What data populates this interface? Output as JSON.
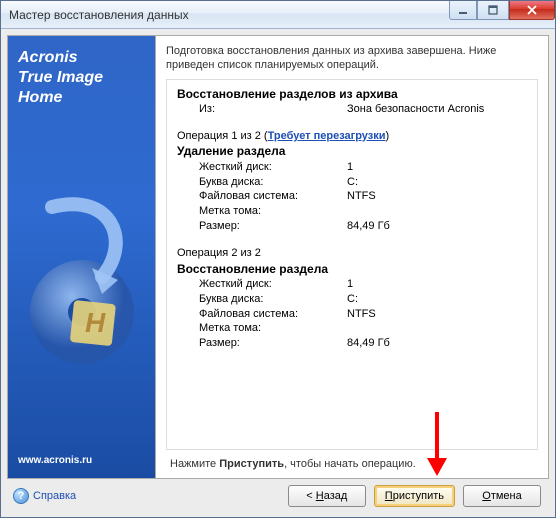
{
  "window": {
    "title": "Мастер восстановления данных"
  },
  "sidebar": {
    "brand_line1": "Acronis",
    "brand_line2": "True Image",
    "brand_line3": "Home",
    "url": "www.acronis.ru"
  },
  "intro": "Подготовка восстановления данных из архива завершена. Ниже приведен список планируемых операций.",
  "section": {
    "title": "Восстановление разделов из архива",
    "from_label": "Из:",
    "from_value": "Зона безопасности Acronis"
  },
  "ops": [
    {
      "heading_prefix": "Операция 1 из 2 (",
      "heading_link": "Требует перезагрузки",
      "heading_suffix": ")",
      "title": "Удаление раздела",
      "rows": {
        "hdd_k": "Жесткий диск:",
        "hdd_v": "1",
        "letter_k": "Буква диска:",
        "letter_v": "C:",
        "fs_k": "Файловая система:",
        "fs_v": "NTFS",
        "label_k": "Метка тома:",
        "label_v": "",
        "size_k": "Размер:",
        "size_v": "84,49 Гб"
      }
    },
    {
      "heading_prefix": "Операция 2 из 2",
      "heading_link": "",
      "heading_suffix": "",
      "title": "Восстановление раздела",
      "rows": {
        "hdd_k": "Жесткий диск:",
        "hdd_v": "1",
        "letter_k": "Буква диска:",
        "letter_v": "C:",
        "fs_k": "Файловая система:",
        "fs_v": "NTFS",
        "label_k": "Метка тома:",
        "label_v": "",
        "size_k": "Размер:",
        "size_v": "84,49 Гб"
      }
    }
  ],
  "hint_prefix": "Нажмите ",
  "hint_bold": "Приступить",
  "hint_suffix": ", чтобы начать операцию.",
  "buttons": {
    "help": "Справка",
    "back_prefix": "< ",
    "back_u": "Н",
    "back_rest": "азад",
    "proceed_u": "П",
    "proceed_rest": "риступить",
    "cancel_u": "О",
    "cancel_rest": "тмена"
  }
}
